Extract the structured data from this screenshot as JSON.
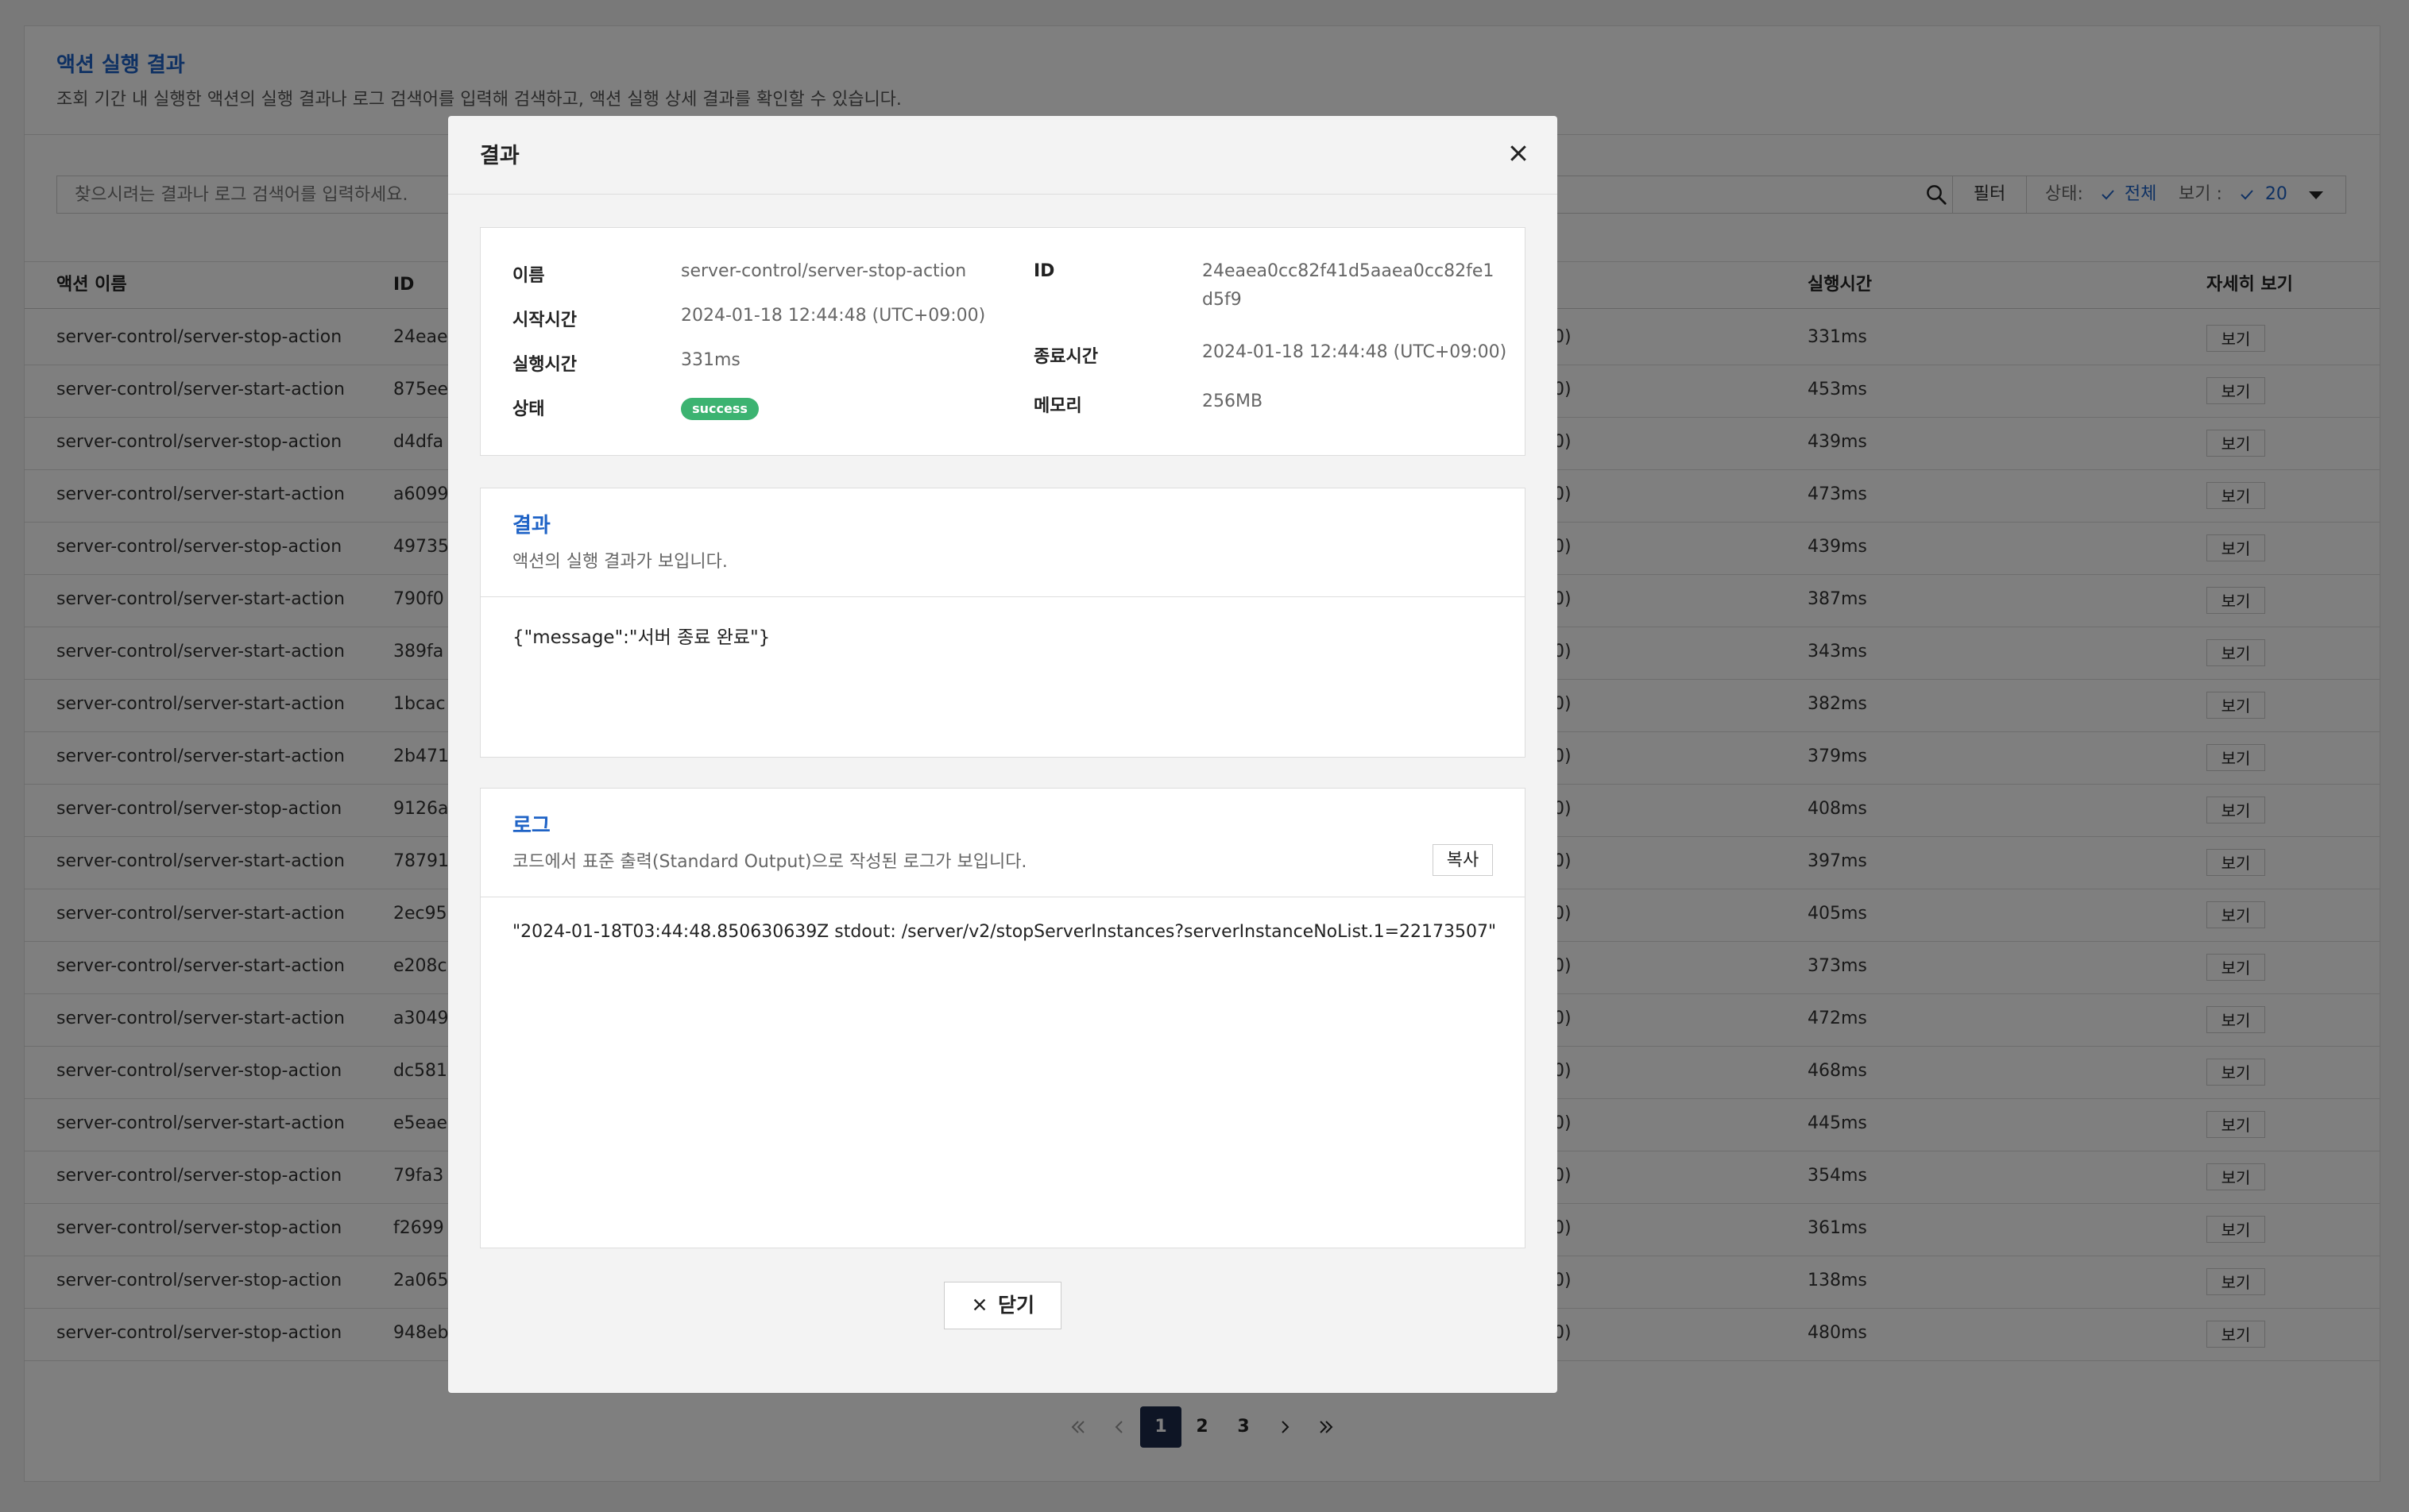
{
  "page": {
    "title": "액션 실행 결과",
    "description": "조회 기간 내 실행한 액션의 실행 결과나 로그 검색어를 입력해 검색하고, 액션 실행 상세 결과를 확인할 수 있습니다."
  },
  "search": {
    "placeholder": "찾으시려는 결과나 로그 검색어를 입력하세요."
  },
  "filter": {
    "button_label": "필터",
    "status_label": "상태:",
    "status_value": "전체",
    "view_label": "보기 :",
    "view_value": "20"
  },
  "table": {
    "headers": {
      "name": "액션 이름",
      "id": "ID",
      "duration": "실행시간",
      "detail": "자세히 보기"
    },
    "view_button_label": "보기",
    "rows": [
      {
        "name": "server-control/server-stop-action",
        "id": "24eae",
        "time_tail": "0)",
        "duration": "331ms"
      },
      {
        "name": "server-control/server-start-action",
        "id": "875ee",
        "time_tail": "0)",
        "duration": "453ms"
      },
      {
        "name": "server-control/server-stop-action",
        "id": "d4dfa",
        "time_tail": "0)",
        "duration": "439ms"
      },
      {
        "name": "server-control/server-start-action",
        "id": "a6099",
        "time_tail": "0)",
        "duration": "473ms"
      },
      {
        "name": "server-control/server-stop-action",
        "id": "49735",
        "time_tail": "0)",
        "duration": "439ms"
      },
      {
        "name": "server-control/server-start-action",
        "id": "790f0",
        "time_tail": "0)",
        "duration": "387ms"
      },
      {
        "name": "server-control/server-start-action",
        "id": "389fa",
        "time_tail": "0)",
        "duration": "343ms"
      },
      {
        "name": "server-control/server-start-action",
        "id": "1bcac",
        "time_tail": "0)",
        "duration": "382ms"
      },
      {
        "name": "server-control/server-start-action",
        "id": "2b471",
        "time_tail": "0)",
        "duration": "379ms"
      },
      {
        "name": "server-control/server-stop-action",
        "id": "9126a",
        "time_tail": "0)",
        "duration": "408ms"
      },
      {
        "name": "server-control/server-start-action",
        "id": "78791",
        "time_tail": "0)",
        "duration": "397ms"
      },
      {
        "name": "server-control/server-start-action",
        "id": "2ec95",
        "time_tail": "0)",
        "duration": "405ms"
      },
      {
        "name": "server-control/server-start-action",
        "id": "e208c",
        "time_tail": "0)",
        "duration": "373ms"
      },
      {
        "name": "server-control/server-start-action",
        "id": "a3049",
        "time_tail": "0)",
        "duration": "472ms"
      },
      {
        "name": "server-control/server-stop-action",
        "id": "dc581",
        "time_tail": "0)",
        "duration": "468ms"
      },
      {
        "name": "server-control/server-start-action",
        "id": "e5eae",
        "time_tail": "0)",
        "duration": "445ms"
      },
      {
        "name": "server-control/server-stop-action",
        "id": "79fa3",
        "time_tail": "0)",
        "duration": "354ms"
      },
      {
        "name": "server-control/server-stop-action",
        "id": "f2699",
        "time_tail": "0)",
        "duration": "361ms"
      },
      {
        "name": "server-control/server-stop-action",
        "id": "2a065",
        "time_tail": "0)",
        "duration": "138ms"
      },
      {
        "name": "server-control/server-stop-action",
        "id": "948eb",
        "time_tail": "0)",
        "duration": "480ms"
      }
    ]
  },
  "pagination": {
    "pages": [
      "1",
      "2",
      "3"
    ],
    "current": "1"
  },
  "modal": {
    "title": "결과",
    "info": {
      "name_label": "이름",
      "name_value": "server-control/server-stop-action",
      "start_label": "시작시간",
      "start_value": "2024-01-18 12:44:48 (UTC+09:00)",
      "duration_label": "실행시간",
      "duration_value": "331ms",
      "status_label": "상태",
      "status_value": "success",
      "id_label": "ID",
      "id_value_line1": "24eaea0cc82f41d5aaea0cc82fe1",
      "id_value_line2": "d5f9",
      "end_label": "종료시간",
      "end_value": "2024-01-18 12:44:48 (UTC+09:00)",
      "memory_label": "메모리",
      "memory_value": "256MB"
    },
    "result": {
      "title": "결과",
      "description": "액션의 실행 결과가 보입니다.",
      "content": "{\"message\":\"서버 종료 완료\"}"
    },
    "log": {
      "title": "로그",
      "description": "코드에서 표준 출력(Standard Output)으로 작성된 로그가 보입니다.",
      "copy_label": "복사",
      "content": "\"2024-01-18T03:44:48.850630639Z stdout: /server/v2/stopServerInstances?serverInstanceNoList.1=22173507\""
    },
    "close_label": "닫기"
  },
  "colors": {
    "accent": "#1f63c6",
    "success": "#3cb371",
    "pager_active": "#1c2b4a"
  }
}
